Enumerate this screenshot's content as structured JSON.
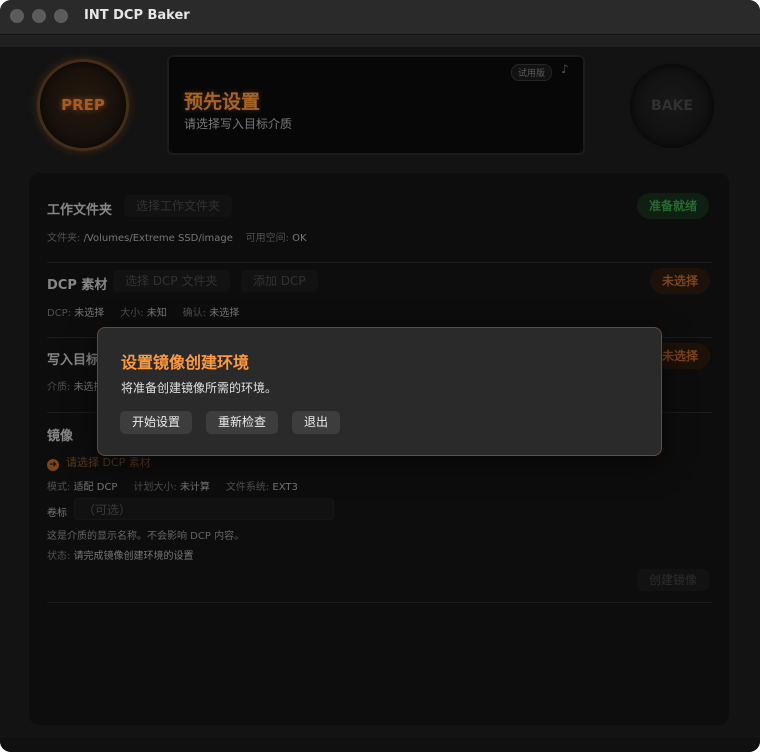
{
  "window": {
    "title": "INT DCP Baker"
  },
  "header": {
    "prep_label": "PREP",
    "bake_label": "BAKE",
    "status_title": "预先设置",
    "status_subtitle": "请选择写入目标介质",
    "trial_badge": "试用版",
    "note_icon": "music-note-icon"
  },
  "workdir": {
    "label": "工作文件夹",
    "choose_button": "选择工作文件夹",
    "status": "准备就绪",
    "info_folder_key": "文件夹:",
    "info_folder_val": "/Volumes/Extreme SSD/image",
    "info_space_key": "可用空间:",
    "info_space_val": "OK"
  },
  "dcp": {
    "label": "DCP 素材",
    "choose_button": "选择 DCP 文件夹",
    "add_button": "添加 DCP",
    "status": "未选择",
    "info_dcp_key": "DCP:",
    "info_dcp_val": "未选择",
    "info_size_key": "大小:",
    "info_size_val": "未知",
    "info_confirm_key": "确认:",
    "info_confirm_val": "未选择"
  },
  "target": {
    "label": "写入目标",
    "status": "未选择",
    "info_media_key": "介质:",
    "info_media_val": "未选择"
  },
  "mirror": {
    "label": "镜像",
    "warning": "请选择 DCP 素材",
    "mode_key": "模式:",
    "mode_val": "适配 DCP",
    "plan_size_key": "计划大小:",
    "plan_size_val": "未计算",
    "fs_key": "文件系统:",
    "fs_val": "EXT3",
    "volume_label": "卷标",
    "volume_placeholder": "（可选）",
    "hint": "这是介质的显示名称。不会影响 DCP 内容。",
    "state_key": "状态:",
    "state_val": "请完成镜像创建环境的设置",
    "create_button": "创建镜像"
  },
  "modal": {
    "title": "设置镜像创建环境",
    "message": "将准备创建镜像所需的环境。",
    "buttons": [
      "开始设置",
      "重新检查",
      "退出"
    ]
  },
  "colors": {
    "accent": "#ff9a3c",
    "ready_green": "#3ca24e",
    "unselected_orange": "#c0682a"
  }
}
